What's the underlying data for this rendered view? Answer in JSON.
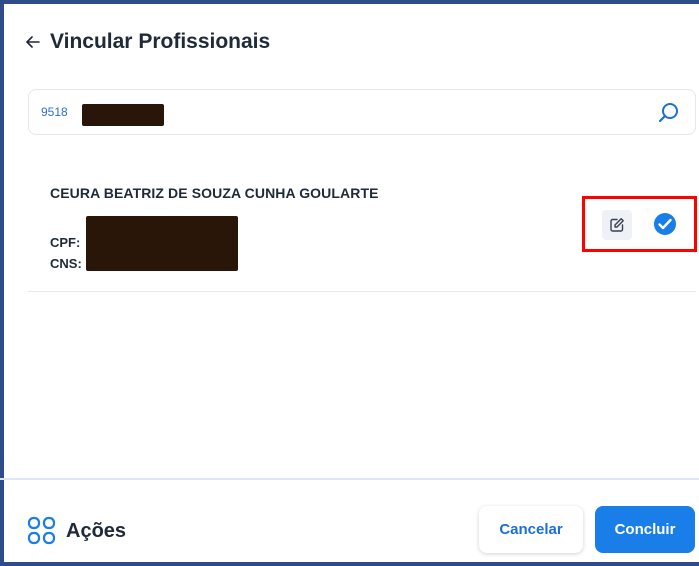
{
  "header": {
    "title": "Vincular Profissionais",
    "back_icon": "arrow-left-icon"
  },
  "search": {
    "value": "9518",
    "icon": "search-icon",
    "accent": "#1a6fd8"
  },
  "professional": {
    "name": "CEURA BEATRIZ DE SOUZA CUNHA GOULARTE",
    "cpf_label": "CPF:",
    "cns_label": "CNS:",
    "edit_icon": "edit-icon",
    "select_icon": "check-circle-icon"
  },
  "footer": {
    "actions_icon": "grid-icon",
    "actions_label": "Ações",
    "cancel_label": "Cancelar",
    "submit_label": "Concluir"
  },
  "colors": {
    "primary": "#1a7ee8",
    "highlight": "#ff0000",
    "redaction": "#2a1608"
  }
}
